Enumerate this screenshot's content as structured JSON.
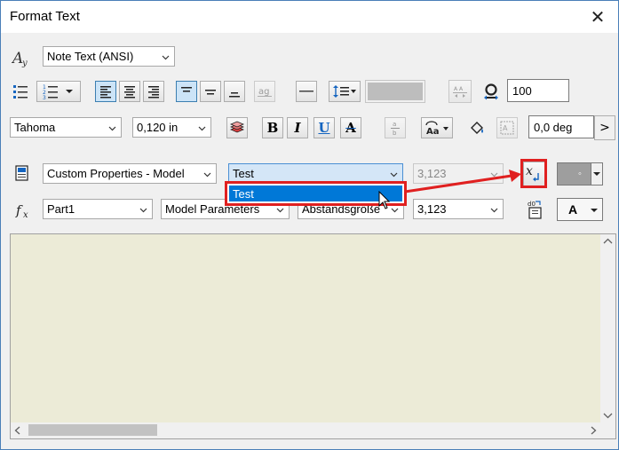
{
  "window": {
    "title": "Format Text",
    "close_glyph": "✕"
  },
  "row1": {
    "style_combo": "Note Text (ANSI)"
  },
  "row2": {
    "text_color_swatch": "#bdbdbd",
    "scale_value": "100"
  },
  "row3": {
    "font_combo": "Tahoma",
    "size_combo": "0,120 in",
    "bold_label": "B",
    "italic_label": "I",
    "underline_label": "U",
    "strike_label": "A",
    "rotation_value": "0,0 deg",
    "more_glyph": ">"
  },
  "row4": {
    "source_combo": "Custom Properties - Model",
    "property_combo": "Test",
    "precision_combo": "3,123",
    "symbol_btn_glyph": "◦"
  },
  "row5": {
    "component_combo": "Part1",
    "param_type_combo": "Model Parameters",
    "param_combo": "Abstandsgröße",
    "param_precision_combo": "3,123",
    "text_case_label": "A"
  },
  "dropdown": {
    "items": [
      "Test"
    ]
  },
  "colors": {
    "editor_bg": "#ecebd7",
    "selection": "#0078d7",
    "annotation_red": "#e02020",
    "accent_blue": "#1565c0"
  }
}
